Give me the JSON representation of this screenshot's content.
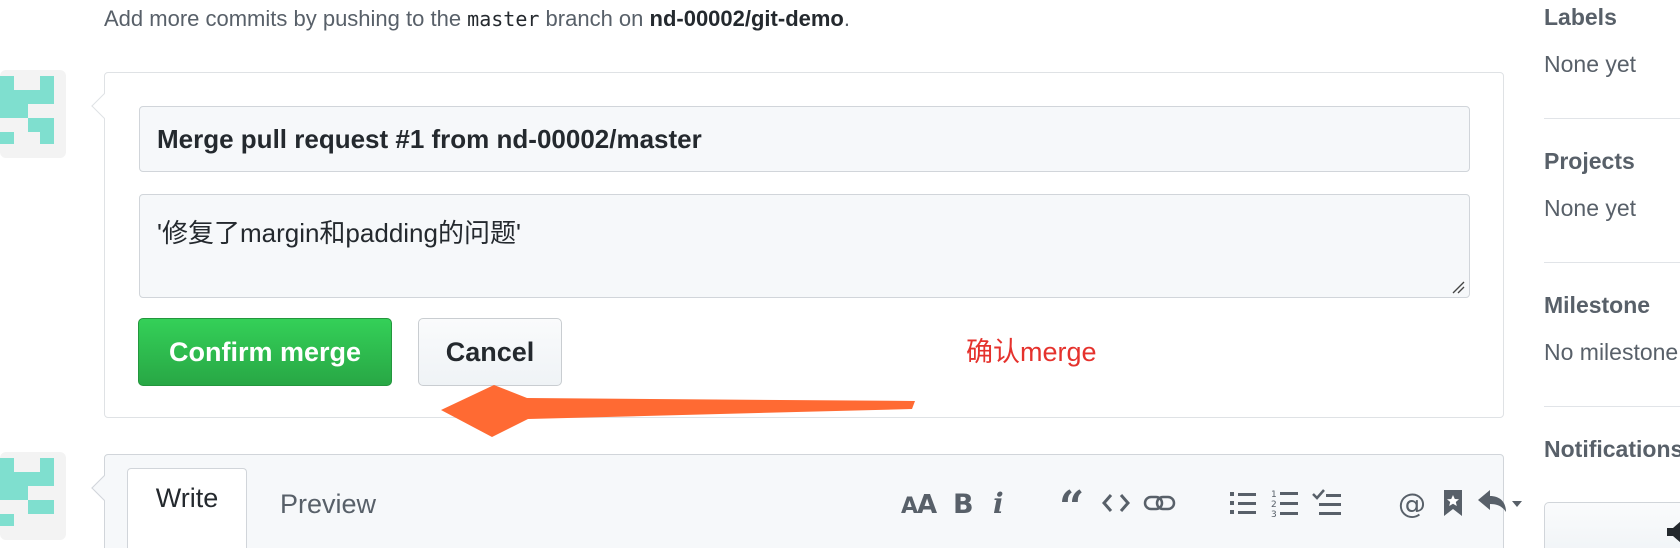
{
  "notice": {
    "prefix": "Add more commits by pushing to the ",
    "branch": "master",
    "middle": " branch on ",
    "repo": "nd-00002/git-demo",
    "suffix": "."
  },
  "merge_form": {
    "commit_title": "Merge pull request #1 from nd-00002/master",
    "commit_body": "'修复了margin和padding的问题'",
    "confirm_label": "Confirm merge",
    "cancel_label": "Cancel"
  },
  "annotation": {
    "text": "确认merge",
    "text_color": "#e5322d",
    "arrow_color": "#ff6a33"
  },
  "comment_editor": {
    "tabs": [
      {
        "label": "Write",
        "active": true
      },
      {
        "label": "Preview",
        "active": false
      }
    ],
    "toolbar_icons": [
      "text-size-icon",
      "bold-icon",
      "italic-icon",
      "quote-icon",
      "code-icon",
      "link-icon",
      "unordered-list-icon",
      "ordered-list-icon",
      "task-list-icon",
      "mention-icon",
      "saved-reply-icon",
      "reply-icon"
    ]
  },
  "sidebar": {
    "sections": [
      {
        "heading": "Labels",
        "value": "None yet"
      },
      {
        "heading": "Projects",
        "value": "None yet"
      },
      {
        "heading": "Milestone",
        "value": "No milestone"
      },
      {
        "heading": "Notifications",
        "value": ""
      }
    ]
  },
  "colors": {
    "confirm_green": "#2ea44f",
    "avatar_teal": "#7fdfcf"
  }
}
